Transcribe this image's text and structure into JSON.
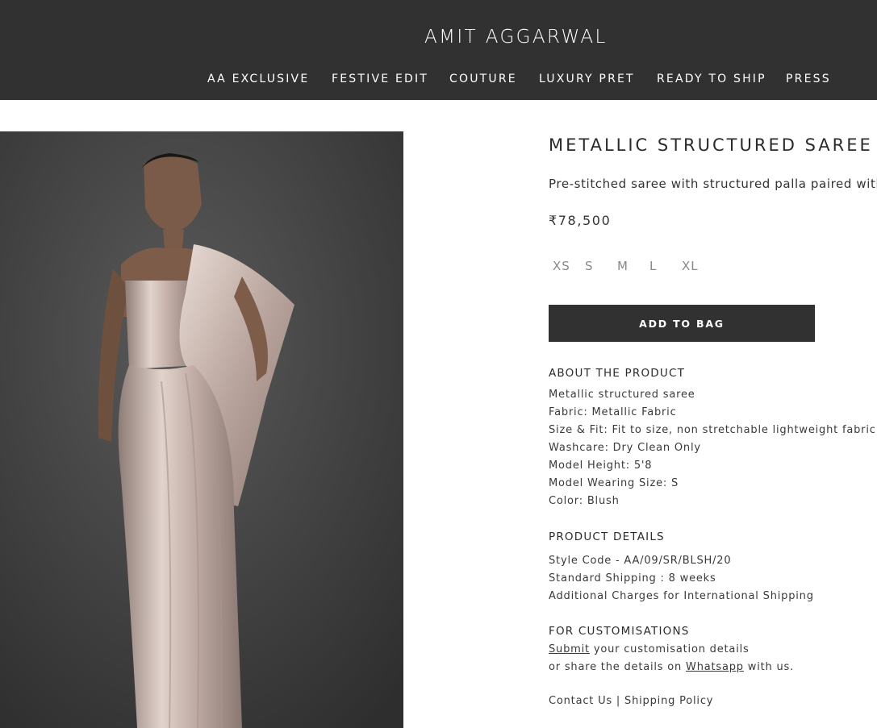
{
  "header": {
    "logo": "AMIT AGGARWAL",
    "nav": [
      "AA EXCLUSIVE",
      "FESTIVE EDIT",
      "COUTURE",
      "LUXURY PRET",
      "READY TO SHIP",
      "PRESS"
    ]
  },
  "product": {
    "title": "METALLIC STRUCTURED SAREE",
    "subtitle": "Pre-stitched saree with structured palla paired with r",
    "price": "₹78,500",
    "sizes": [
      "XS",
      "S",
      "M",
      "L",
      "XL"
    ],
    "add_to_bag": "ADD TO BAG",
    "image_icon": "model-wearing-saree-image"
  },
  "about": {
    "heading": "ABOUT THE PRODUCT",
    "lines": [
      "Metallic structured saree",
      "Fabric: Metallic Fabric",
      "Size & Fit: Fit to size, non stretchable lightweight fabric",
      "Washcare: Dry Clean Only",
      "Model Height: 5'8",
      "Model Wearing Size: S",
      "Color: Blush"
    ]
  },
  "details": {
    "heading": "PRODUCT DETAILS",
    "lines": [
      "Style Code - AA/09/SR/BLSH/20",
      "Standard Shipping : 8 weeks",
      "Additional Charges for International Shipping"
    ]
  },
  "custom": {
    "heading": "FOR CUSTOMISATIONS",
    "submit_link": "Submit",
    "line1_rest": " your customisation details",
    "line2_start": "or share the details on ",
    "whatsapp_link": "Whatsapp",
    "line2_end": " with us."
  },
  "footer_links": {
    "contact": "Contact Us",
    "separator": " | ",
    "shipping": "Shipping Policy"
  },
  "colors": {
    "header_bg": "#313131",
    "button_bg": "#313131",
    "backdrop": "#4a4a4a",
    "saree": "#cbb8b0"
  }
}
